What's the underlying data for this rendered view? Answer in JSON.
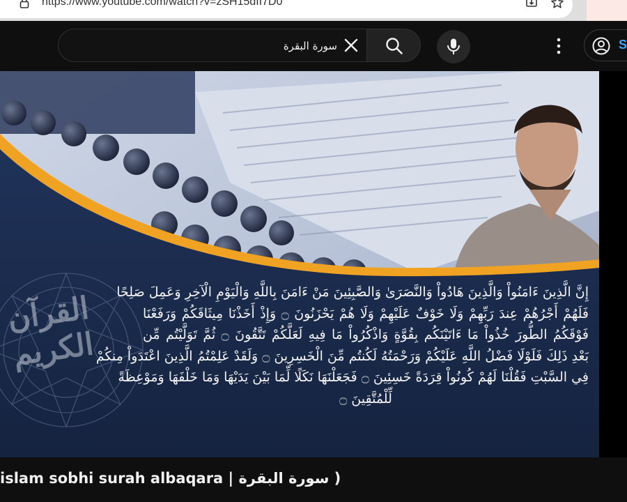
{
  "browser": {
    "url": "https://www.youtube.com/watch?v=zSH15dII7D0"
  },
  "search": {
    "query": "سورة البقرة"
  },
  "header": {
    "signin_label": "S"
  },
  "icons": {
    "lock": "lock-icon",
    "clear": "close-icon",
    "search": "search-icon",
    "mic": "mic-icon",
    "more": "more-vert-icon",
    "account": "account-circle-icon"
  },
  "video": {
    "verse_lines": [
      "إِنَّ الَّذِينَ ءَامَنُواْ وَالَّذِينَ هَادُواْ وَالنَّصَرَىٰ وَالصَّبِئِينَ مَنْ ءَامَنَ بِاللَّهِ وَالْيَوْمِ الْآخِرِ وَعَمِلَ صَلِحًا",
      "فَلَهُمْ أَجْرُهُمْ عِندَ رَبِّهِمْ وَلَا خَوْفٌ عَلَيْهِمْ وَلَا هُمْ يَحْزَنُونَ ۝ وَإِذْ أَخَذْنَا مِيثَاقَكُمْ وَرَفَعْنَا",
      "فَوْقَكُمُ الطُّورَ خُذُواْ مَا ءَاتَيْنَكُم بِقُوَّةٍ وَاذْكُرُواْ مَا فِيهِ لَعَلَّكُمْ تَتَّقُونَ ۝ ثُمَّ تَوَلَّيْتُم مِّن",
      "بَعْدِ ذَلِكَ فَلَوْلَا فَضْلُ اللَّهِ عَلَيْكُمْ وَرَحْمَتُهُ لَكُنتُم مِّنَ الْخَسِرِينَ ۝ وَلَقَدْ عَلِمْتُمُ الَّذِينَ اعْتَدَواْ مِنكُمْ",
      "فِي السَّبْتِ فَقُلْنَا لَهُمْ كُونُواْ قِرَدَةً خَسِئِينَ ۝ فَجَعَلْنَهَا نَكَلًا لِّمَا بَيْنَ يَدَيْهَا وَمَا خَلْفَهَا وَمَوْعِظَةً",
      "لِّلْمُتَّقِينَ ۝"
    ],
    "calligraphy": "القرآن الكريم"
  },
  "title": {
    "text": "( سورة البقرة | islam sobhi surah albaqara"
  },
  "colors": {
    "background": "#0f0f0f",
    "frame_orange": "#f0a323",
    "panel_navy": "#1a2a48"
  }
}
